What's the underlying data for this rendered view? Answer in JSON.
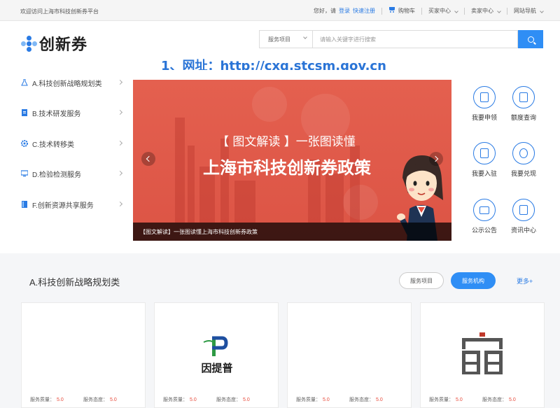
{
  "topbar": {
    "welcome": "欢迎访问上海市科技创新券平台",
    "hello": "您好，请",
    "login": "登录",
    "register": "快速注册",
    "cart": "购物车",
    "buyer_center": "买家中心",
    "seller_center": "卖家中心",
    "site_nav": "网站导航"
  },
  "header": {
    "logo_text": "创新券",
    "search_category": "服务项目",
    "search_placeholder": "请输入关键字进行搜索"
  },
  "annotation": {
    "url_note": "1、网址：http://cxq.stcsm.gov.cn"
  },
  "categories": [
    {
      "label": "A.科技创新战略规划类",
      "icon": "flask-icon"
    },
    {
      "label": "B.技术研发服务",
      "icon": "document-icon"
    },
    {
      "label": "C.技术转移类",
      "icon": "gear-icon"
    },
    {
      "label": "D.检验检测服务",
      "icon": "monitor-icon"
    },
    {
      "label": "F.创新资源共享服务",
      "icon": "book-icon"
    }
  ],
  "banner": {
    "title1": "【 图文解读 】一张图读懂",
    "title2": "上海市科技创新券政策",
    "caption": "【图文解读】一张图读懂上海市科技创新券政策"
  },
  "quick_links": [
    {
      "label": "我要申领",
      "icon": "apply-icon"
    },
    {
      "label": "额度查询",
      "icon": "quota-query-icon"
    },
    {
      "label": "我要入驻",
      "icon": "settle-in-icon"
    },
    {
      "label": "我要兑现",
      "icon": "redeem-icon"
    },
    {
      "label": "公示公告",
      "icon": "announcement-icon"
    },
    {
      "label": "资讯中心",
      "icon": "news-center-icon"
    }
  ],
  "section": {
    "title": "A.科技创新战略规划类",
    "btn_projects": "服务项目",
    "btn_agencies": "服务机构",
    "more": "更多+"
  },
  "cards": [
    {
      "quality_label": "服务质量：",
      "quality": "5.0",
      "attitude_label": "服务态度：",
      "attitude": "5.0",
      "logo_text": ""
    },
    {
      "quality_label": "服务质量：",
      "quality": "5.0",
      "attitude_label": "服务态度：",
      "attitude": "5.0",
      "logo_text": "因提普"
    },
    {
      "quality_label": "服务质量：",
      "quality": "5.0",
      "attitude_label": "服务态度：",
      "attitude": "5.0",
      "logo_text": ""
    },
    {
      "quality_label": "服务质量：",
      "quality": "5.0",
      "attitude_label": "服务态度：",
      "attitude": "5.0",
      "logo_text": ""
    }
  ],
  "colors": {
    "brand_blue": "#2f8ef5",
    "banner_red": "#e0584a",
    "rating_red": "#e84a3a"
  }
}
